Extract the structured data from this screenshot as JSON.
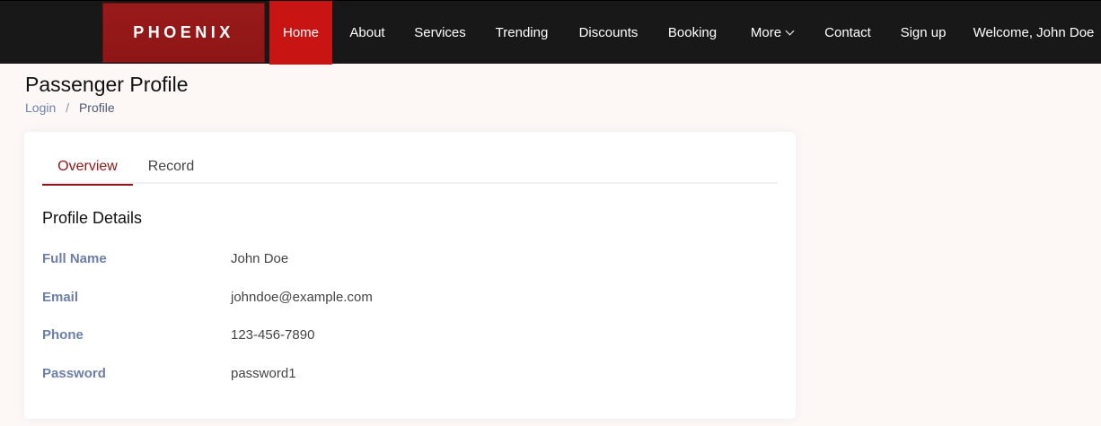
{
  "brand": {
    "name": "PHOENIX"
  },
  "nav": {
    "items": [
      {
        "label": "Home"
      },
      {
        "label": "About"
      },
      {
        "label": "Services"
      },
      {
        "label": "Trending"
      },
      {
        "label": "Discounts"
      },
      {
        "label": "Booking"
      },
      {
        "label": "More"
      },
      {
        "label": "Contact"
      },
      {
        "label": "Sign up"
      },
      {
        "label": "Welcome, John Doe"
      }
    ]
  },
  "page": {
    "title": "Passenger Profile",
    "breadcrumb": {
      "link": "Login",
      "separator": "/",
      "current": "Profile"
    }
  },
  "tabs": [
    {
      "label": "Overview"
    },
    {
      "label": "Record"
    }
  ],
  "profile": {
    "section_title": "Profile Details",
    "rows": [
      {
        "label": "Full Name",
        "value": "John Doe"
      },
      {
        "label": "Email",
        "value": "johndoe@example.com"
      },
      {
        "label": "Phone",
        "value": "123-456-7890"
      },
      {
        "label": "Password",
        "value": "password1"
      }
    ]
  },
  "colors": {
    "navbar": "#181818",
    "brand": "#8e1616",
    "active_nav": "#c91414",
    "accent": "#8e1616"
  }
}
